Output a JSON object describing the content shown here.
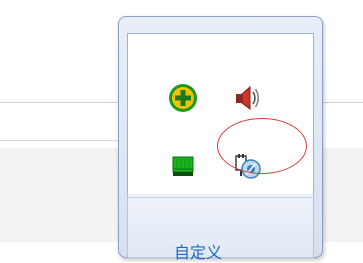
{
  "tray_popup": {
    "customize_link": "自定义",
    "icons": [
      {
        "name": "add-plus-icon",
        "color": "#f2c200"
      },
      {
        "name": "speaker-volume-icon",
        "color": "#c8392b"
      },
      {
        "name": "network-green-icon",
        "color": "#16b51d"
      },
      {
        "name": "usb-safely-remove-icon",
        "color": "#3c7fc4"
      }
    ]
  },
  "annotation": {
    "highlight_color": "#d63b3b"
  },
  "colors": {
    "popup_border": "#8aa0bd",
    "link": "#1a66cc"
  }
}
